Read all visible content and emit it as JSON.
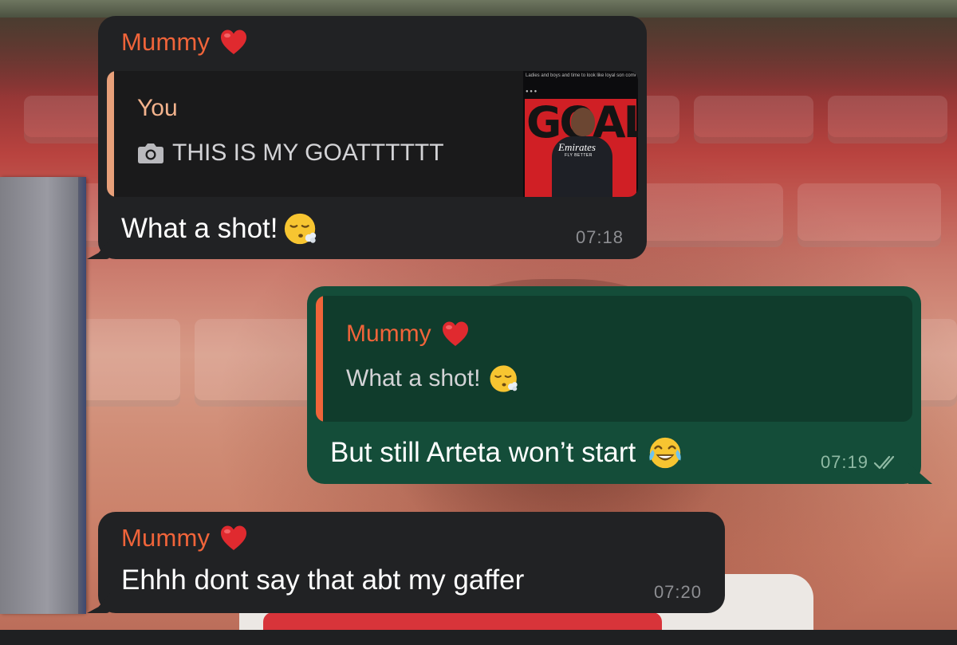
{
  "chat": {
    "messages": [
      {
        "id": "m1",
        "direction": "incoming",
        "sender": "Mummy",
        "sender_emoji": "red-heart",
        "quote": {
          "author": "You",
          "media_label": "THIS IS MY GOATTTTTT",
          "media_icon": "camera-icon",
          "thumbnail": {
            "top_text": "Ladies and boys and time to look like loyal son come",
            "headline": "GOAL!",
            "sponsor": "Emirates",
            "sponsor_sub": "FLY BETTER"
          }
        },
        "text": "What a shot!",
        "text_emoji": "face-exhaling",
        "time": "07:18"
      },
      {
        "id": "m2",
        "direction": "outgoing",
        "quote": {
          "author": "Mummy",
          "author_emoji": "red-heart",
          "text": "What a shot!",
          "text_emoji": "face-exhaling"
        },
        "text": "But still Arteta won’t start",
        "text_emoji": "face-with-tears-of-joy",
        "time": "07:19",
        "status": "read"
      },
      {
        "id": "m3",
        "direction": "incoming",
        "sender": "Mummy",
        "sender_emoji": "red-heart",
        "text": "Ehhh dont say that abt my gaffer",
        "time": "07:20"
      }
    ]
  },
  "colors": {
    "incoming_bubble": "#212224",
    "outgoing_bubble": "#144d39",
    "sender_name": "#f0643a",
    "quote_bar_you": "#e8a07a",
    "quote_bar_mummy": "#f0643a",
    "quote_author_you": "#f3b38d",
    "timestamp": "#8d8e92"
  }
}
